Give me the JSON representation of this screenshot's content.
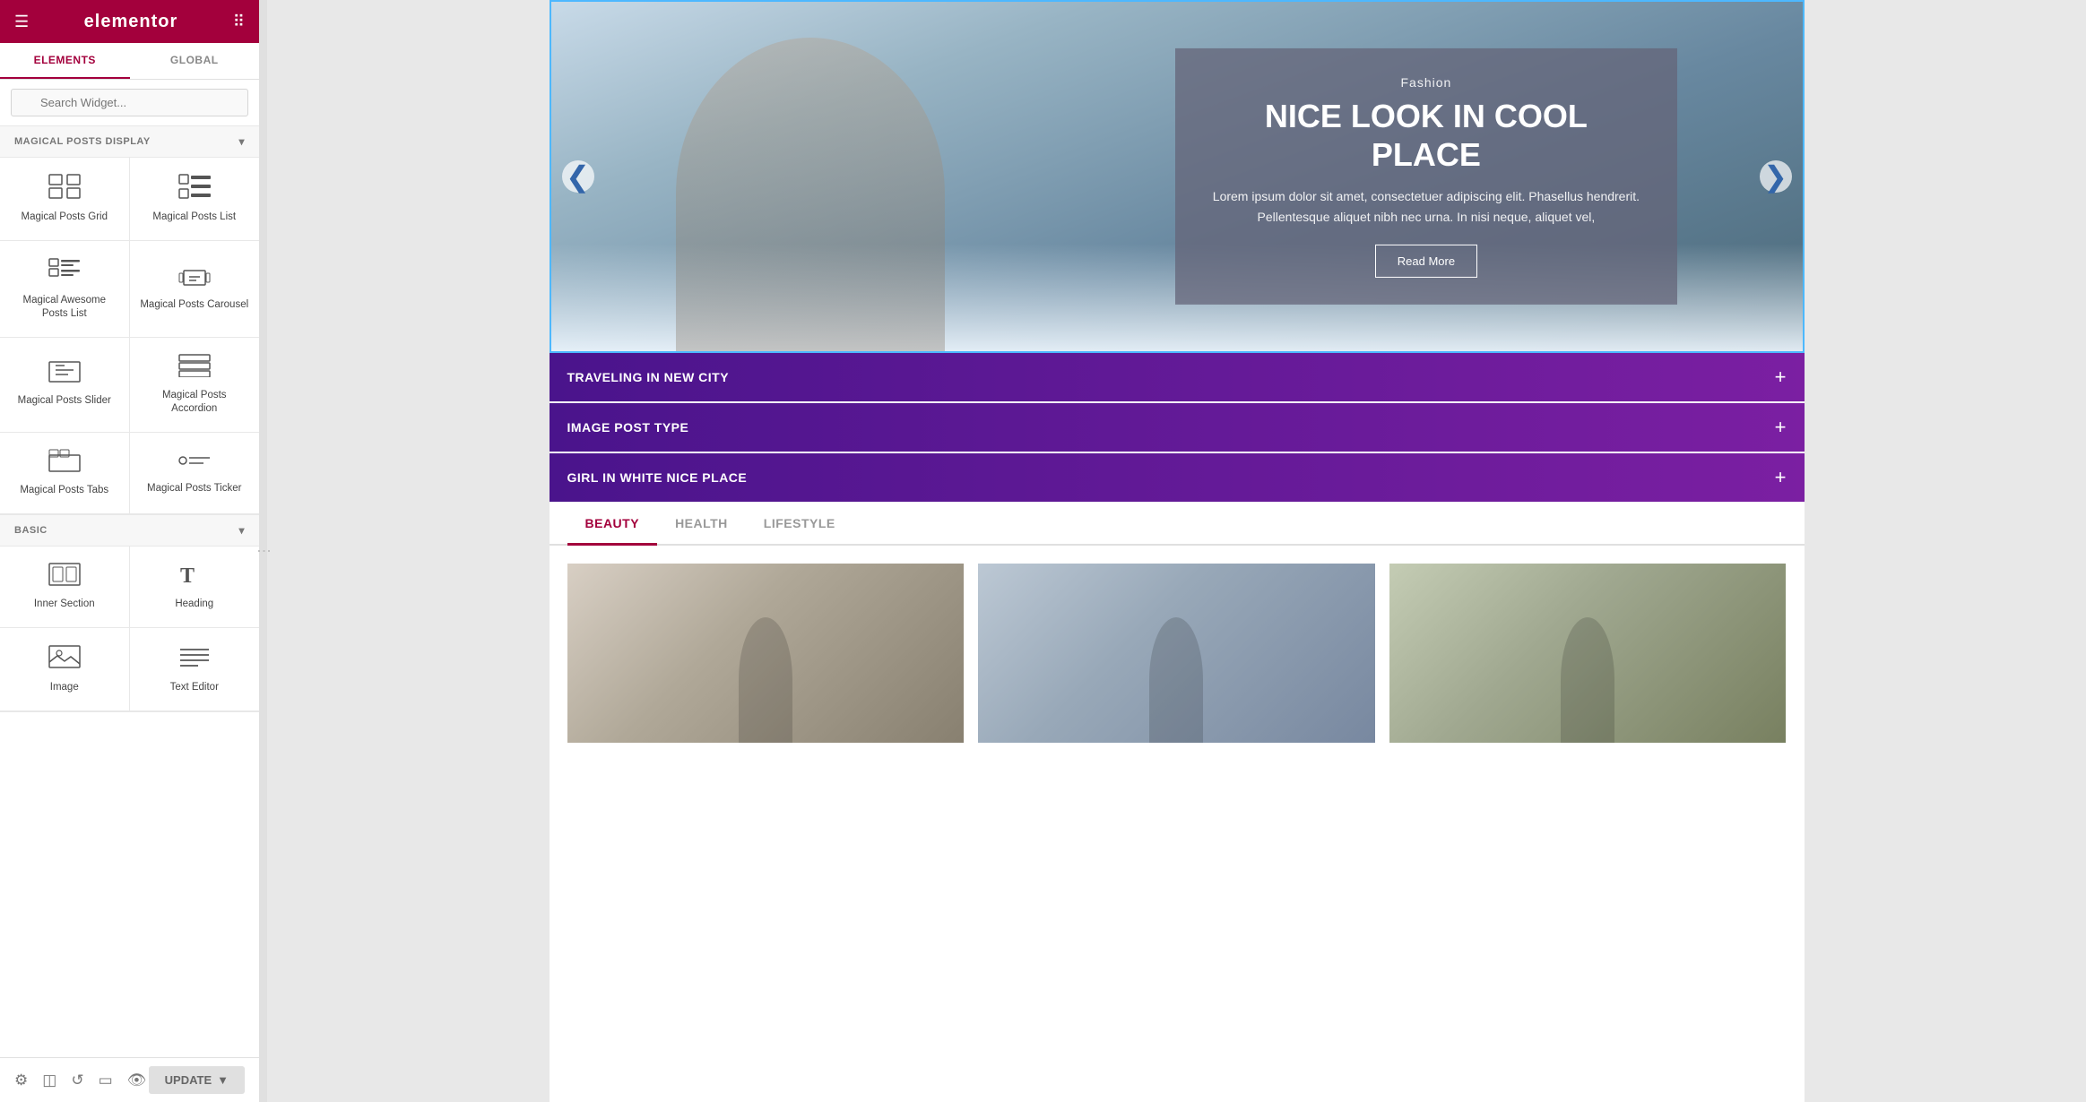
{
  "panel": {
    "logo": "elementor",
    "tabs": [
      {
        "id": "elements",
        "label": "ELEMENTS",
        "active": true
      },
      {
        "id": "global",
        "label": "GLOBAL",
        "active": false
      }
    ],
    "search": {
      "placeholder": "Search Widget..."
    },
    "sections": [
      {
        "id": "magical-posts-display",
        "label": "MAGICAL POSTS DISPLAY",
        "widgets": [
          {
            "id": "posts-grid",
            "label": "Magical Posts Grid",
            "icon": "grid"
          },
          {
            "id": "posts-list",
            "label": "Magical Posts List",
            "icon": "list"
          },
          {
            "id": "awesome-posts-list",
            "label": "Magical Awesome Posts List",
            "icon": "awesome-list"
          },
          {
            "id": "posts-carousel",
            "label": "Magical Posts Carousel",
            "icon": "carousel"
          },
          {
            "id": "posts-slider",
            "label": "Magical Posts Slider",
            "icon": "slider"
          },
          {
            "id": "posts-accordion",
            "label": "Magical Posts Accordion",
            "icon": "accordion"
          },
          {
            "id": "posts-tabs",
            "label": "Magical Posts Tabs",
            "icon": "tabs"
          },
          {
            "id": "posts-ticker",
            "label": "Magical Posts Ticker",
            "icon": "ticker"
          }
        ]
      },
      {
        "id": "basic",
        "label": "BASIC",
        "widgets": [
          {
            "id": "inner-section",
            "label": "Inner Section",
            "icon": "inner-section"
          },
          {
            "id": "heading",
            "label": "Heading",
            "icon": "heading"
          },
          {
            "id": "image",
            "label": "Image",
            "icon": "image"
          },
          {
            "id": "text-editor",
            "label": "Text Editor",
            "icon": "text-editor"
          }
        ]
      }
    ],
    "footer": {
      "update_label": "UPDATE",
      "update_arrow": "▼"
    }
  },
  "canvas": {
    "carousel": {
      "category": "Fashion",
      "title": "NICE LOOK IN COOL PLACE",
      "excerpt": "Lorem ipsum dolor sit amet, consectetuer adipiscing elit. Phasellus hendrerit. Pellentesque aliquet nibh nec urna. In nisi neque, aliquet vel,",
      "button_label": "Read More",
      "arrow_left": "❮",
      "arrow_right": "❯"
    },
    "accordion": {
      "items": [
        {
          "title": "TRAVELING IN NEW CITY",
          "icon": "+"
        },
        {
          "title": "IMAGE POST TYPE",
          "icon": "+"
        },
        {
          "title": "GIRL IN WHITE NICE PLACE",
          "icon": "+"
        }
      ]
    },
    "tabs": {
      "items": [
        {
          "label": "BEAUTY",
          "active": true
        },
        {
          "label": "HEALTH",
          "active": false
        },
        {
          "label": "LIFESTYLE",
          "active": false
        }
      ]
    }
  }
}
